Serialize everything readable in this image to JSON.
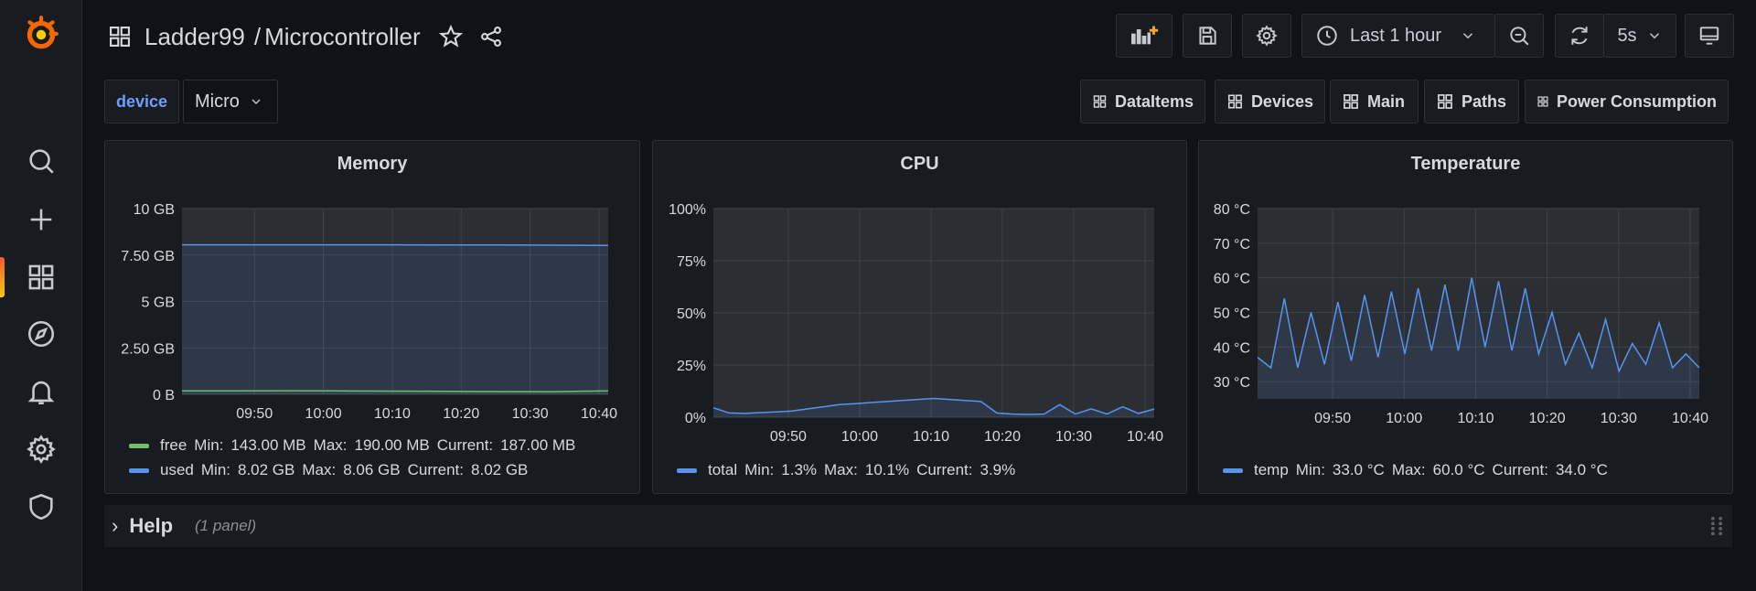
{
  "nav": {
    "folder": "Ladder99",
    "separator": "/",
    "dashboard": "Microcontroller",
    "time_range": "Last 1 hour",
    "refresh_interval": "5s"
  },
  "variable": {
    "label": "device",
    "value": "Micro"
  },
  "links": [
    {
      "label": "DataItems"
    },
    {
      "label": "Devices"
    },
    {
      "label": "Main"
    },
    {
      "label": "Paths"
    },
    {
      "label": "Power Consumption"
    }
  ],
  "panels": {
    "memory": {
      "title": "Memory",
      "legend": [
        {
          "name": "free",
          "min": "143.00 MB",
          "max": "190.00 MB",
          "current": "187.00 MB",
          "color": "#73bf69"
        },
        {
          "name": "used",
          "min": "8.02 GB",
          "max": "8.06 GB",
          "current": "8.02 GB",
          "color": "#5794f2"
        }
      ]
    },
    "cpu": {
      "title": "CPU",
      "legend": [
        {
          "name": "total",
          "min": "1.3%",
          "max": "10.1%",
          "current": "3.9%",
          "color": "#5794f2"
        }
      ]
    },
    "temperature": {
      "title": "Temperature",
      "legend": [
        {
          "name": "temp",
          "min": "33.0 °C",
          "max": "60.0 °C",
          "current": "34.0 °C",
          "color": "#5794f2"
        }
      ]
    }
  },
  "legend_labels": {
    "min": "Min:",
    "max": "Max:",
    "current": "Current:"
  },
  "row": {
    "title": "Help",
    "count": "(1 panel)"
  },
  "chart_data": [
    {
      "type": "area",
      "title": "Memory",
      "x_ticks": [
        "09:50",
        "10:00",
        "10:10",
        "10:20",
        "10:30",
        "10:40"
      ],
      "y_ticks": [
        "0 B",
        "2.50 GB",
        "5 GB",
        "7.50 GB",
        "10 GB"
      ],
      "ylim": [
        0,
        10
      ],
      "yunit": "GB",
      "series": [
        {
          "name": "free",
          "values": [
            0.187,
            0.185,
            0.19,
            0.18,
            0.17,
            0.16,
            0.15,
            0.143,
            0.187
          ],
          "color": "#73bf69"
        },
        {
          "name": "used",
          "values": [
            8.05,
            8.05,
            8.05,
            8.05,
            8.05,
            8.04,
            8.04,
            8.03,
            8.02
          ],
          "color": "#5794f2"
        }
      ]
    },
    {
      "type": "area",
      "title": "CPU",
      "x_ticks": [
        "09:50",
        "10:00",
        "10:10",
        "10:20",
        "10:30",
        "10:40"
      ],
      "y_ticks": [
        "0%",
        "25%",
        "50%",
        "75%",
        "100%"
      ],
      "ylim": [
        0,
        100
      ],
      "series": [
        {
          "name": "total",
          "values": [
            4.5,
            2.0,
            1.8,
            2.2,
            2.5,
            3.0,
            4.0,
            5.0,
            6.0,
            6.5,
            7.0,
            7.5,
            8.0,
            8.5,
            9.0,
            8.5,
            8.0,
            7.5,
            2.0,
            1.5,
            1.3,
            1.5,
            6.0,
            1.5,
            4.0,
            1.5,
            5.0,
            1.8,
            3.9
          ],
          "color": "#5794f2"
        }
      ]
    },
    {
      "type": "area",
      "title": "Temperature",
      "x_ticks": [
        "09:50",
        "10:00",
        "10:10",
        "10:20",
        "10:30",
        "10:40"
      ],
      "y_ticks": [
        "30 °C",
        "40 °C",
        "50 °C",
        "60 °C",
        "70 °C",
        "80 °C"
      ],
      "ylim": [
        25,
        80
      ],
      "series": [
        {
          "name": "temp",
          "values": [
            37,
            34,
            54,
            34,
            50,
            35,
            53,
            36,
            55,
            37,
            56,
            38,
            57,
            39,
            58,
            39,
            60,
            40,
            59,
            39,
            57,
            38,
            50,
            35,
            44,
            34,
            48,
            33,
            41,
            35,
            47,
            34,
            38,
            34
          ],
          "color": "#5794f2"
        }
      ]
    }
  ]
}
